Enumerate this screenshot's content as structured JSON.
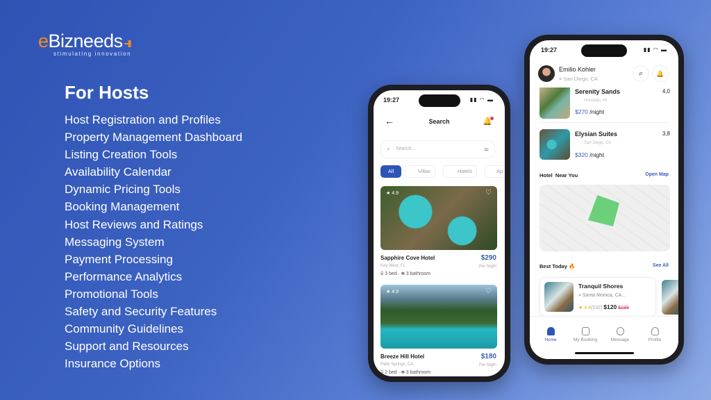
{
  "brand": {
    "name_e": "e",
    "name_rest": "Bizneeds",
    "tagline": "stimulating innovation",
    "accent": "#f08a24"
  },
  "heading": "For Hosts",
  "features": [
    "Host Registration and Profiles",
    "Property Management Dashboard",
    "Listing Creation Tools",
    "Availability Calendar",
    "Dynamic Pricing Tools",
    "Booking Management",
    "Host Reviews and Ratings",
    "Messaging System",
    "Payment Processing",
    "Performance Analytics",
    "Promotional Tools",
    "Safety and Security Features",
    "Community Guidelines",
    "Support and Resources",
    "Insurance Options"
  ],
  "phone1": {
    "time": "19:27",
    "title": "Search",
    "search_placeholder": "Search...",
    "chips": [
      "All",
      "Villas",
      "Hotels",
      "Ap"
    ],
    "hotels": [
      {
        "rating": "4.9",
        "name": "Sapphire Cove Hotel",
        "location": "Key West, FL",
        "price": "$290",
        "per": "Per Night",
        "beds": "3 bed",
        "baths": "3 bathroom"
      },
      {
        "rating": "4.9",
        "name": "Breeze Hill Hotel",
        "location": "Palm Springs, CA",
        "price": "$180",
        "per": "Per Night",
        "beds": "2 bed",
        "baths": "3 bathroom"
      }
    ]
  },
  "phone2": {
    "time": "19:27",
    "user": "Emilio Kohler",
    "user_location": "San Diego, CA",
    "listings": [
      {
        "name": "Serenity Sands",
        "location": "Honolulu, HI",
        "rating": "4,0",
        "price": "$270",
        "unit": "/night"
      },
      {
        "name": "Elysian Suites",
        "location": "San Diego, CA",
        "rating": "3,8",
        "price": "$320",
        "unit": "/night"
      }
    ],
    "near_title": "Hotel  Near You",
    "open_map": "Open Map",
    "best_title": "Best Today 🔥",
    "see_all": "See All",
    "best": {
      "name": "Tranquil Shores",
      "location": "Santa Monica, CA...",
      "rating": "4.4",
      "reviews": "(532)",
      "price": "$120",
      "old_price": "$199"
    },
    "nav": [
      "Home",
      "My Booking",
      "Message",
      "Profile"
    ]
  }
}
